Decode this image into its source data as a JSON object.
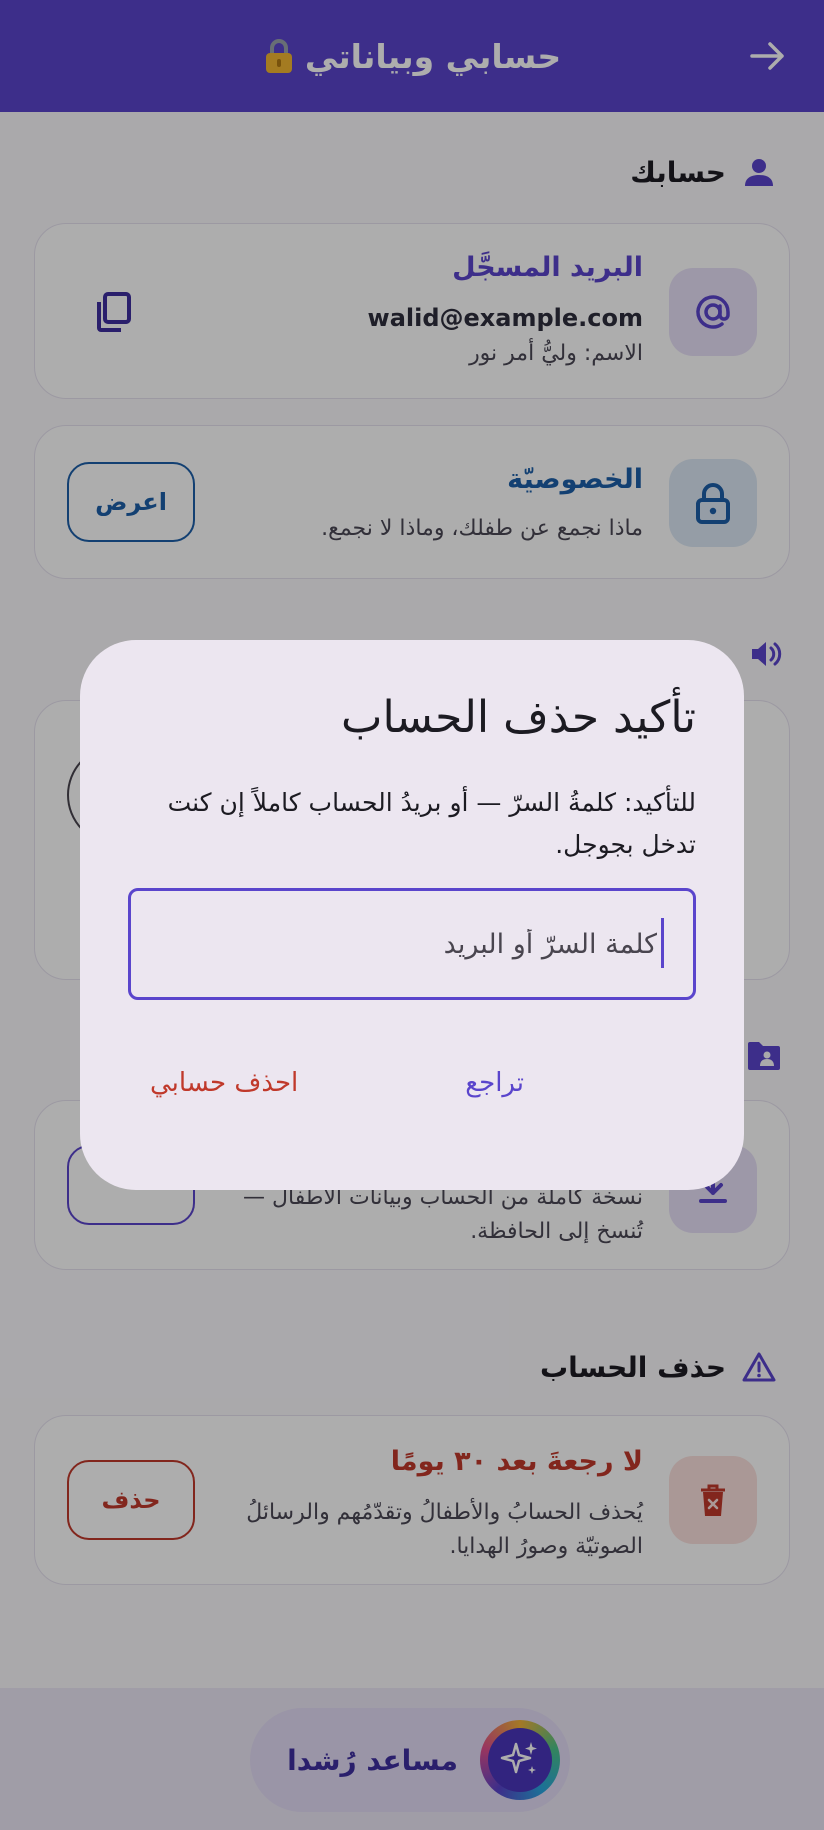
{
  "app_bar": {
    "title": "حسابي وبياناتي",
    "back_icon": "arrow-back-icon",
    "lock_icon": "lock-emoji-icon"
  },
  "account_section": {
    "title": "حسابك",
    "email_card": {
      "title": "البريد المسجَّل",
      "email": "walid@example.com",
      "name_line": "الاسم: وليُّ أمر نور"
    },
    "privacy_card": {
      "title": "الخصوصيّة",
      "subtitle": "ماذا نجمع عن طفلك، وماذا لا نجمع.",
      "button": "اعرض"
    }
  },
  "export_card": {
    "line1": "نسخة كاملة من الحساب وبيانات الأطفال —",
    "line2": "تُنسخ إلى الحافظة."
  },
  "delete_section": {
    "title": "حذف الحساب",
    "card": {
      "title": "لا رجعةَ بعد ٣٠ يومًا",
      "line1": "يُحذف الحسابُ والأطفالُ وتقدّمُهم والرسائلُ",
      "line2": "الصوتيّة وصورُ الهدايا.",
      "button": "حذف"
    }
  },
  "assistant": {
    "label": "مساعد رُشدا"
  },
  "dialog": {
    "title": "تأكيد حذف الحساب",
    "body": "للتأكيد: كلمةُ السرّ — أو بريدُ الحساب كاملاً إن كنت تدخل بجوجل.",
    "input_placeholder": "كلمة السرّ أو البريد",
    "cancel_button": "تراجع",
    "confirm_button": "احذف حسابي"
  },
  "colors": {
    "primary": "#5a45cc",
    "privacy_blue": "#1d5fa8",
    "danger": "#c0392b",
    "scrim": "rgba(0,0,0,0.32)"
  }
}
